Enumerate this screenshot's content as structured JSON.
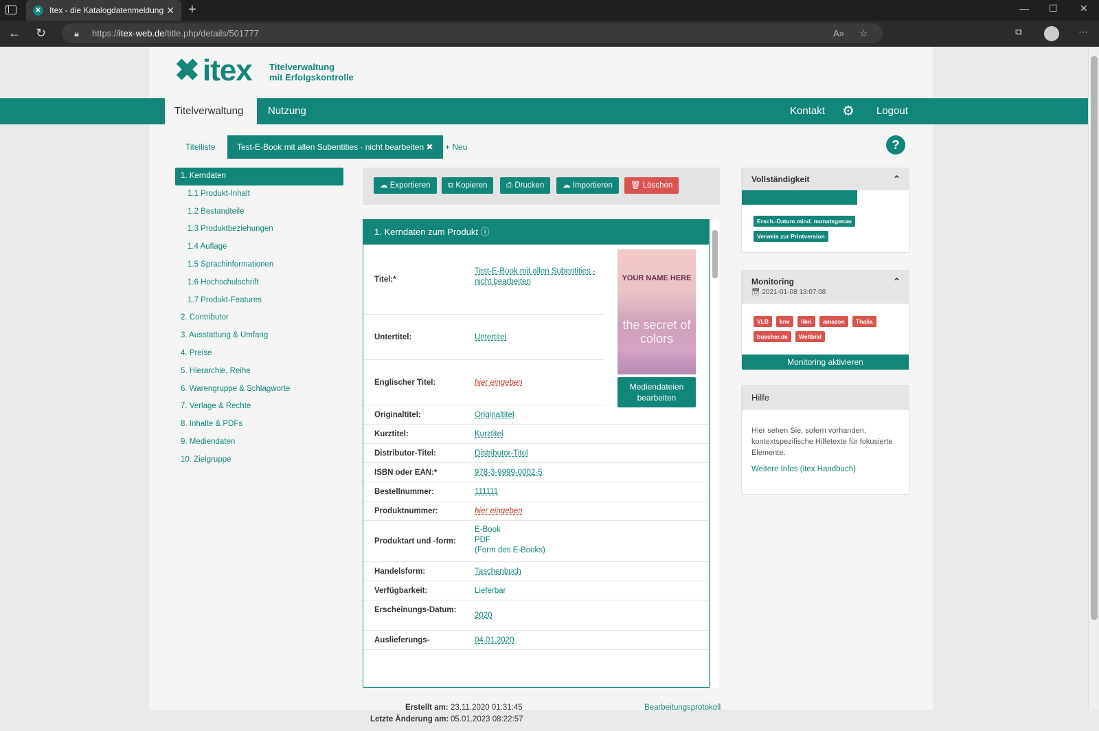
{
  "browser": {
    "tab_title": "Itex - die Katalogdatenmeldung",
    "url_prefix": "https://",
    "url_domain": "itex-web.de",
    "url_path": "/title.php/details/501777"
  },
  "brand": {
    "logo_text": "itex",
    "tagline_1": "Titelverwaltung",
    "tagline_2": "mit Erfolgskontrolle",
    "accent_color": "#13867a"
  },
  "mainnav": {
    "titelverwaltung": "Titelverwaltung",
    "nutzung": "Nutzung",
    "kontakt": "Kontakt",
    "logout": "Logout"
  },
  "subtabs": {
    "titelliste": "Titelliste",
    "current": "Test-E-Book mit allen Subentities - nicht bearbeiten ✖",
    "neu": "+ Neu"
  },
  "leftnav": [
    {
      "label": "1. Kerndaten",
      "sub": false,
      "active": true
    },
    {
      "label": "1.1 Produkt-Inhalt",
      "sub": true
    },
    {
      "label": "1.2 Bestandteile",
      "sub": true
    },
    {
      "label": "1.3 Produktbeziehungen",
      "sub": true
    },
    {
      "label": "1.4 Auflage",
      "sub": true
    },
    {
      "label": "1.5 Sprachinformationen",
      "sub": true
    },
    {
      "label": "1.6 Hochschulschrift",
      "sub": true
    },
    {
      "label": "1.7 Produkt-Features",
      "sub": true
    },
    {
      "label": "2. Contributor",
      "sub": false
    },
    {
      "label": "3. Ausstattung & Umfang",
      "sub": false
    },
    {
      "label": "4. Preise",
      "sub": false
    },
    {
      "label": "5. Hierarchie, Reihe",
      "sub": false
    },
    {
      "label": "6. Warengruppe & Schlagworte",
      "sub": false
    },
    {
      "label": "7. Verlage & Rechte",
      "sub": false
    },
    {
      "label": "8. Inhalte & PDFs",
      "sub": false
    },
    {
      "label": "9. Mediendaten",
      "sub": false
    },
    {
      "label": "10. Zielgruppe",
      "sub": false
    }
  ],
  "toolbar": {
    "export": "Exportieren",
    "copy": "Kopieren",
    "print": "Drucken",
    "import": "Importieren",
    "delete": "Löschen"
  },
  "panel": {
    "title": "1. Kerndaten zum Produkt",
    "cover_line1": "YOUR NAME HERE",
    "cover_line2": "the secret of colors",
    "media_button": "Mediendateien bearbeiten",
    "rows": [
      {
        "label": "Titel:*",
        "value": "Test-E-Book mit allen Subentities - nicht bearbeiten",
        "type": "link"
      },
      {
        "label": "Untertitel:",
        "value": "Untertitel",
        "type": "link"
      },
      {
        "label": "Englischer Titel:",
        "value": "hier eingeben",
        "type": "empty"
      },
      {
        "label": "Originaltitel:",
        "value": "Originaltitel",
        "type": "link"
      },
      {
        "label": "Kurztitel:",
        "value": "Kurztitel",
        "type": "link"
      },
      {
        "label": "Distributor-Titel:",
        "value": "Distributor-Titel",
        "type": "link"
      },
      {
        "label": "ISBN oder EAN:*",
        "value": "978-3-9999-0002-5",
        "type": "link"
      },
      {
        "label": "Bestellnummer:",
        "value": "111111",
        "type": "link"
      },
      {
        "label": "Produktnummer:",
        "value": "hier eingeben",
        "type": "empty"
      },
      {
        "label": "Produktart und -form:",
        "value": "E-Book\nPDF\n(Form des E-Books)",
        "type": "plain"
      },
      {
        "label": "Handelsform:",
        "value": "Taschenbuch",
        "type": "link"
      },
      {
        "label": "Verfügbarkeit:",
        "value": "Lieferbar",
        "type": "plain"
      },
      {
        "label": "Erscheinungs-Datum:",
        "value": "2020",
        "type": "link"
      },
      {
        "label": "Auslieferungs-",
        "value": "04.01.2020",
        "type": "link"
      }
    ]
  },
  "meta": {
    "created_label": "Erstellt am:",
    "created_value": "23.11.2020 01:31:45",
    "changed_label": "Letzte Änderung am:",
    "changed_value": "05.01.2023 08:22:57",
    "log_link": "Bearbeitungsprotokoll"
  },
  "completeness": {
    "title": "Vollständigkeit",
    "progress_fraction": 0.69,
    "badges": [
      "Ersch.-Datum mind. monatsgenau",
      "Verweis zur Printversion"
    ]
  },
  "monitoring": {
    "title": "Monitoring",
    "date": "2021-01-08 13:07:08",
    "shops": [
      "VLB",
      "knv",
      "libri",
      "amazon",
      "Thalia",
      "buecher.de",
      "Weltbild"
    ],
    "button": "Monitoring aktivieren"
  },
  "help": {
    "title": "Hilfe",
    "text": "Hier sehen Sie, sofern vorhanden, kontextspezifische Hilfetexte für fokusierte Elemente.",
    "link": "Weitere Infos (itex Handbuch)"
  }
}
